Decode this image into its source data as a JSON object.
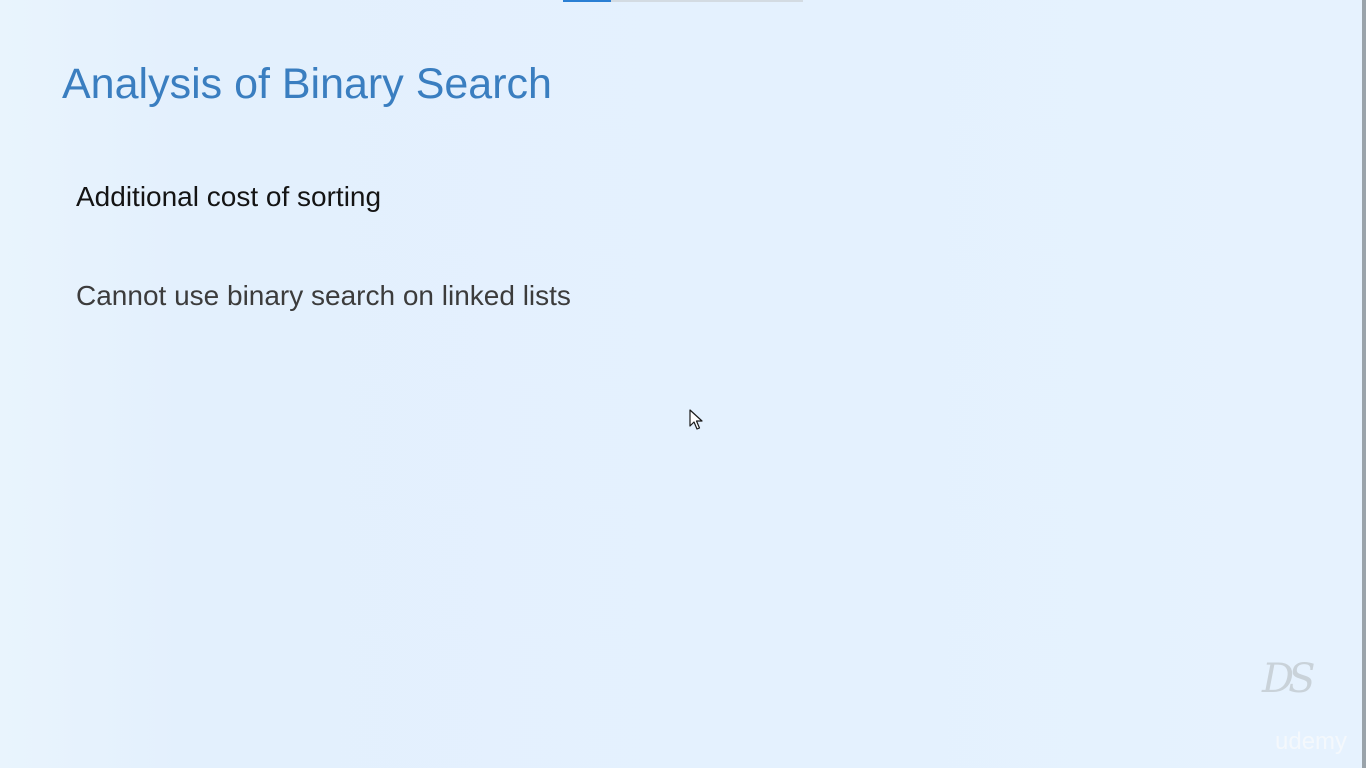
{
  "slide": {
    "title": "Analysis of Binary Search",
    "bullets": [
      "Additional cost of sorting",
      "Cannot use binary search on linked lists"
    ]
  },
  "player": {
    "progress_fraction": 0.2
  },
  "watermark": {
    "logo_text": "DS",
    "brand_text": "udemy"
  },
  "colors": {
    "background": "#e4f1fd",
    "title": "#3a7ec0",
    "bullet_primary": "#141414",
    "bullet_secondary": "#3c3c3c",
    "progress": "#2a7fd4"
  },
  "icons": {
    "pointer": "mouse-pointer-icon"
  }
}
